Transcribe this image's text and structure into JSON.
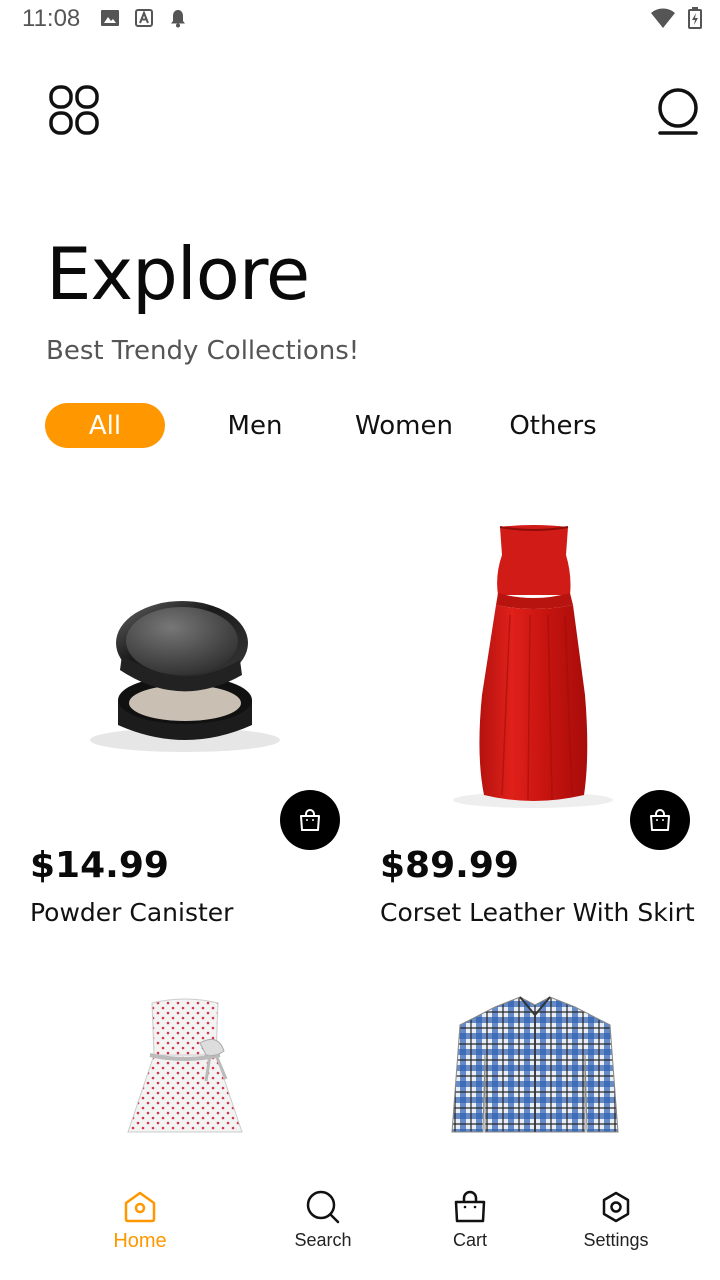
{
  "status_bar": {
    "time": "11:08",
    "icons": [
      "image-icon",
      "a-icon",
      "bell-icon",
      "wifi-icon",
      "battery-icon"
    ]
  },
  "header": {
    "title": "Explore",
    "subtitle": "Best Trendy Collections!"
  },
  "categories": {
    "items": [
      "All",
      "Men",
      "Women",
      "Others"
    ],
    "selected": "All"
  },
  "products": [
    {
      "price": "$14.99",
      "name": "Powder Canister"
    },
    {
      "price": "$89.99",
      "name": "Corset Leather With Skirt"
    },
    {
      "price": "",
      "name": ""
    },
    {
      "price": "",
      "name": ""
    }
  ],
  "bottom_nav": {
    "items": [
      {
        "label": "Home",
        "icon": "home-icon",
        "active": true
      },
      {
        "label": "Search",
        "icon": "search-icon",
        "active": false
      },
      {
        "label": "Cart",
        "icon": "bag-icon",
        "active": false
      },
      {
        "label": "Settings",
        "icon": "gear-icon",
        "active": false
      }
    ]
  },
  "colors": {
    "accent": "#ff9800",
    "text": "#111111",
    "muted": "#555555",
    "button_dark": "#000000"
  }
}
